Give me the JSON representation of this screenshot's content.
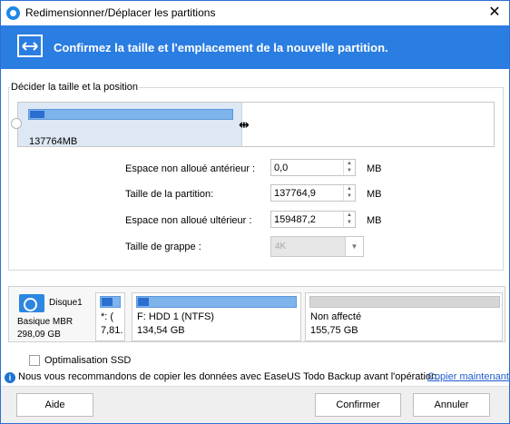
{
  "window": {
    "title": "Redimensionner/Déplacer les partitions",
    "close_glyph": "✕",
    "icon": "app-disk-icon"
  },
  "banner": {
    "text": "Confirmez la taille et l'emplacement de la nouvelle partition.",
    "icon": "resize-arrows-icon",
    "color": "#2a7de1"
  },
  "sizing": {
    "group_label": "Décider la taille et la position",
    "partition_size_label": "137764MB",
    "partition_fraction": 0.463
  },
  "fields": {
    "unalloc_before": {
      "label": "Espace non alloué antérieur :",
      "value": "0,0",
      "unit": "MB"
    },
    "partition_size": {
      "label": "Taille de la partition:",
      "value": "137764,9",
      "unit": "MB"
    },
    "unalloc_after": {
      "label": "Espace non alloué ultérieur :",
      "value": "159487,2",
      "unit": "MB"
    },
    "cluster_size": {
      "label": "Taille de grappe :",
      "value": "4K"
    }
  },
  "disk": {
    "name": "Disque1",
    "type": "Basique MBR",
    "size": "298,09 GB",
    "partitions": [
      {
        "name": "*: (",
        "size": "7,81.",
        "color": "#7fb3ec"
      },
      {
        "name": "F: HDD 1 (NTFS)",
        "size": "134,54 GB",
        "color": "#7fb3ec"
      },
      {
        "name": "Non affecté",
        "size": "155,75 GB",
        "color": "#d6d6d6"
      }
    ]
  },
  "ssd": {
    "label": "Optimalisation SSD",
    "checked": false
  },
  "info": {
    "text": "Nous vous recommandons de copier les données avec EaseUS Todo Backup avant l'opération.",
    "link": "Copier maintenant"
  },
  "buttons": {
    "help": "Aide",
    "confirm": "Confirmer",
    "cancel": "Annuler"
  }
}
